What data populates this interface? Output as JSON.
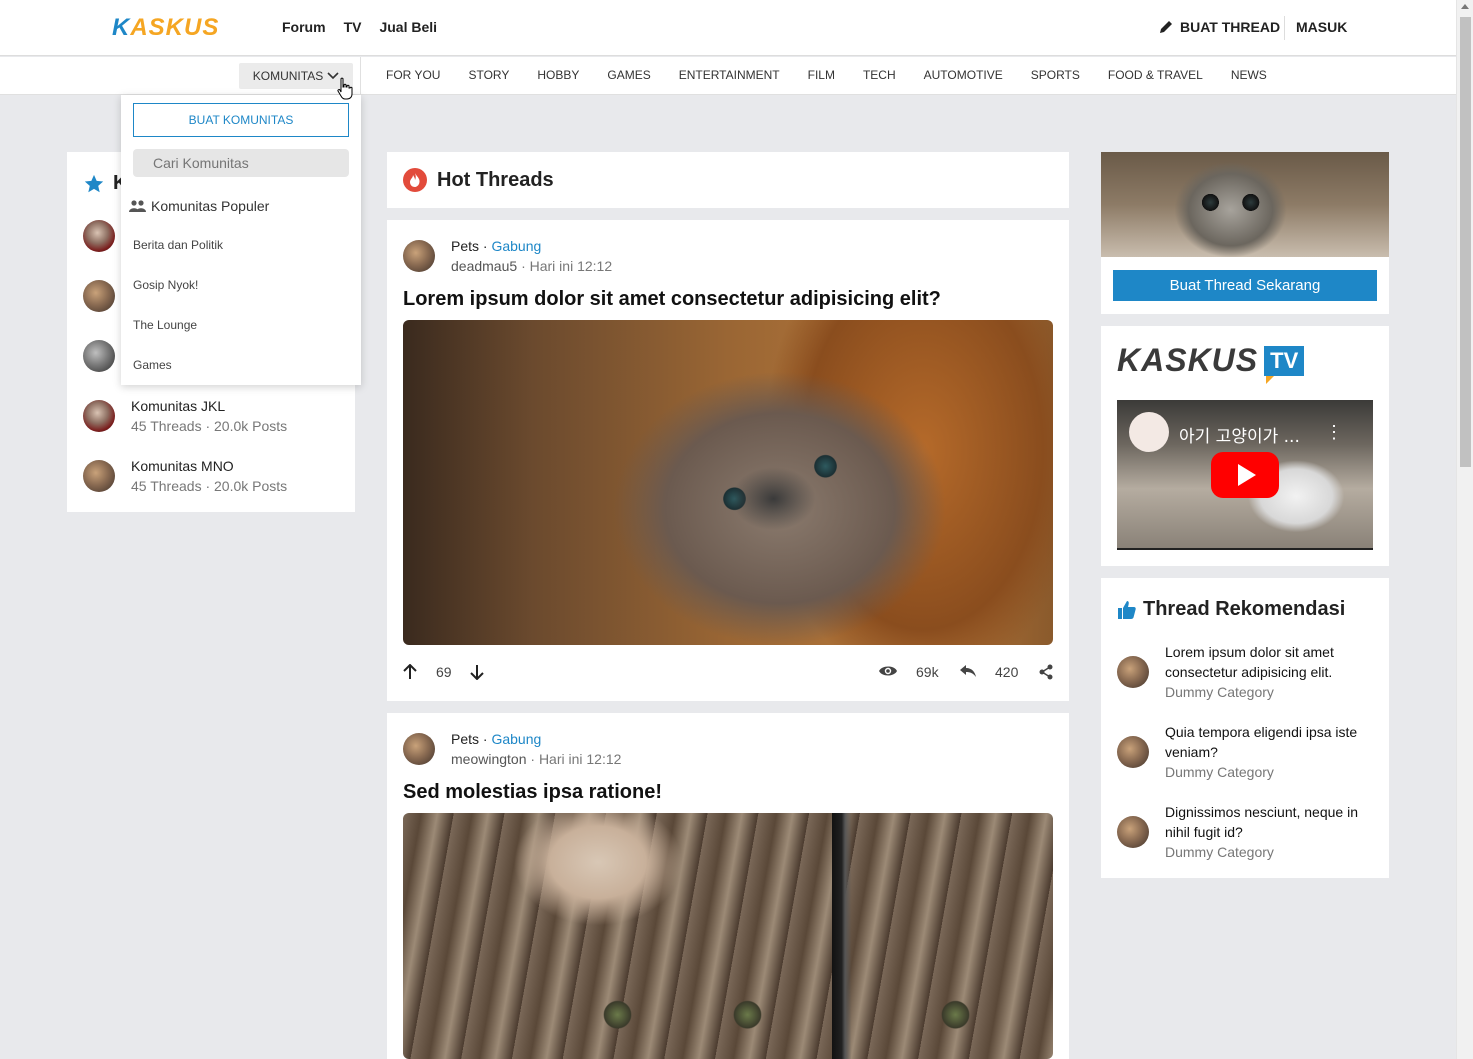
{
  "header": {
    "logo": "KASKUS",
    "nav": [
      "Forum",
      "TV",
      "Jual Beli"
    ],
    "buat_thread": "BUAT THREAD",
    "masuk": "MASUK"
  },
  "catbar": {
    "komunitas": "KOMUNITAS",
    "categories": [
      "FOR YOU",
      "STORY",
      "HOBBY",
      "GAMES",
      "ENTERTAINMENT",
      "FILM",
      "TECH",
      "AUTOMOTIVE",
      "SPORTS",
      "FOOD & TRAVEL",
      "NEWS"
    ]
  },
  "dropdown": {
    "create_button": "BUAT KOMUNITAS",
    "search_placeholder": "Cari Komunitas",
    "popular_heading": "Komunitas Populer",
    "items": [
      "Berita dan Politik",
      "Gosip Nyok!",
      "The Lounge",
      "Games"
    ]
  },
  "left": {
    "title_initial": "K",
    "items": [
      {
        "name": "Komunitas JKL",
        "meta": "45 Threads · 20.0k Posts"
      },
      {
        "name": "Komunitas MNO",
        "meta": "45 Threads · 20.0k Posts"
      }
    ]
  },
  "main": {
    "hot_title": "Hot Threads",
    "posts": [
      {
        "category": "Pets",
        "join": "Gabung",
        "user": "deadmau5",
        "time": "· Hari ini 12:12",
        "title": "Lorem ipsum dolor sit amet consectetur adipisicing elit?",
        "votes": "69",
        "views": "69k",
        "replies": "420"
      },
      {
        "category": "Pets",
        "join": "Gabung",
        "user": "meowington",
        "time": "· Hari ini 12:12",
        "title": "Sed molestias ipsa ratione!"
      }
    ]
  },
  "right": {
    "promo_button": "Buat Thread Sekarang",
    "tv_logo": "KASKUS",
    "tv_badge": "TV",
    "video_title": "아기 고양이가 ...",
    "rekom_title": "Thread Rekomendasi",
    "rekom_items": [
      {
        "title": "Lorem ipsum dolor sit amet consectetur adipisicing elit.",
        "category": "Dummy Category"
      },
      {
        "title": "Quia tempora eligendi ipsa iste veniam?",
        "category": "Dummy Category"
      },
      {
        "title": "Dignissimos nesciunt, neque in nihil fugit id?",
        "category": "Dummy Category"
      }
    ]
  },
  "colors": {
    "brand_blue": "#1e87c7",
    "brand_orange": "#f5a623",
    "fire_red": "#e24b3b"
  }
}
